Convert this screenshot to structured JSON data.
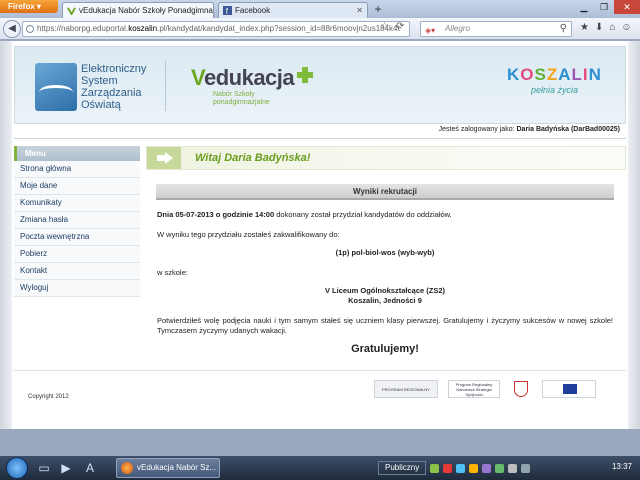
{
  "browser": {
    "menu_button": "Firefox",
    "tabs": [
      {
        "label": "vEdukacja Nabór Szkoły Ponadgimna...",
        "active": true
      },
      {
        "label": "Facebook",
        "active": false
      }
    ],
    "url_prefix": "https://naborpg.eduportal.",
    "url_domain": "koszalin",
    "url_rest": ".pl/kandydat/kandydat_index.php?session_id=88r6moovjn2us184k4t",
    "search_placeholder": "Allegro"
  },
  "header": {
    "ezs": [
      "Elektroniczny",
      "System",
      "Zarządzania",
      "Oświatą"
    ],
    "vedukacja_title": "edukacja",
    "vedukacja_sub1": "Nabór Szkoły",
    "vedukacja_sub2": "ponadgimnazjalne",
    "city_letters": [
      "K",
      "O",
      "S",
      "Z",
      "A",
      "L",
      "I",
      "N"
    ],
    "city_tagline": "pełnia życia"
  },
  "login": {
    "prefix": "Jesteś zalogowany jako:",
    "user": "Daria Badyńska (DarBad00025)"
  },
  "menu": {
    "title": "Menu",
    "items": [
      "Strona główna",
      "Moje dane",
      "Komunikaty",
      "Zmiana hasła",
      "Poczta wewnętrzna",
      "Pobierz",
      "Kontakt",
      "Wyloguj"
    ]
  },
  "main": {
    "welcome": "Witaj Daria Badyńska!",
    "section_title": "Wyniki rekrutacji",
    "date_text": "Dnia 05-07-2013 o godzinie 14:00",
    "date_tail": " dokonany został przydział kandydatów do oddziałów.",
    "qualified": "W wyniku tego przydziału zostałeś zakwalifikowany do:",
    "class_name": "(1p) pol-biol-wos (wyb-wyb)",
    "at_school": "w szkole:",
    "school_name": "V Liceum Ogólnokształcące (ZS2)",
    "school_address": "Koszalin, Jedności 9",
    "confirmation": "Potwierdziłeś wolę podjęcia nauki i tym samym stałeś się uczniem klasy pierwszej. Gratulujemy i życzymy sukcesów w nowej szkole! Tymczasem życzymy udanych wakacji.",
    "congrats": "Gratulujemy!"
  },
  "footer": {
    "copyright": "Copyright 2012",
    "logo1": "PROGRAM REGIONALNY",
    "logo2": "Program Regionalny Narodowa Strategia Spójności"
  },
  "taskbar": {
    "task_label": "vEdukacja Nabór Sz...",
    "keyboard": "Publiczny",
    "clock": "13:37"
  }
}
